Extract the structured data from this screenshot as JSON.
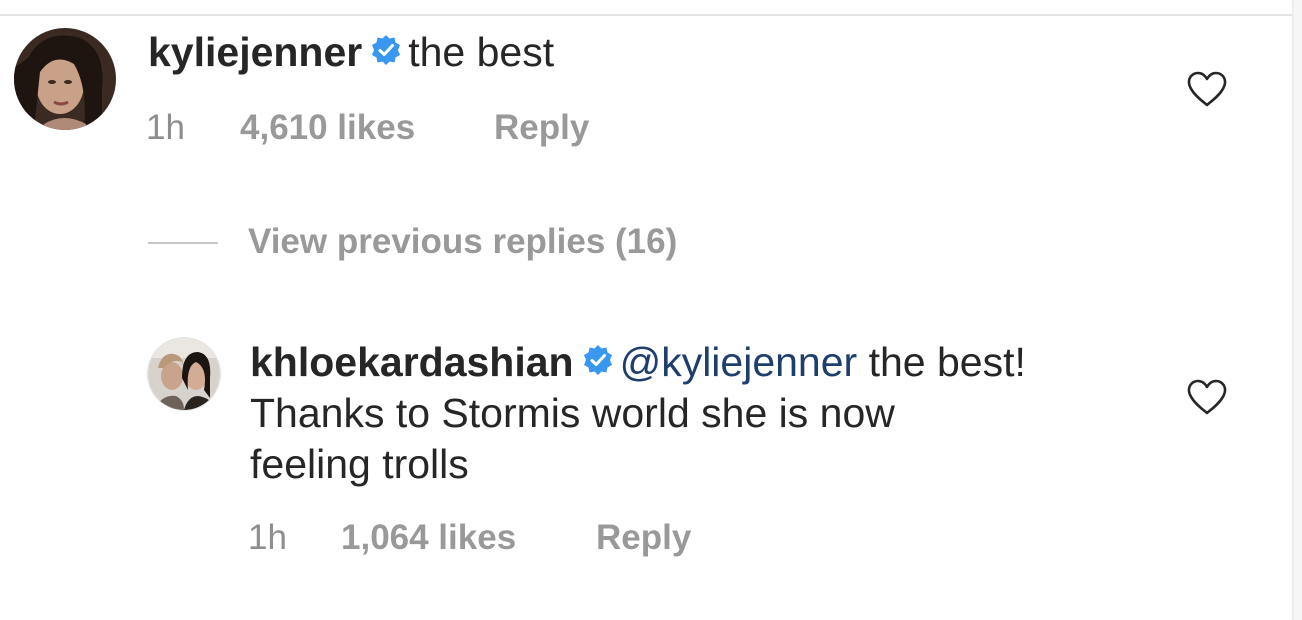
{
  "comment": {
    "username": "kyliejenner",
    "text": "the best",
    "time": "1h",
    "likes": "4,610 likes",
    "reply_label": "Reply"
  },
  "thread": {
    "view_replies_label": "View previous replies (16)"
  },
  "reply": {
    "username": "khloekardashian",
    "mention": "@kyliejenner",
    "text_line1": "the best!",
    "text_line2": "Thanks to Stormis world she is now",
    "text_line3": "feeling trolls",
    "time": "1h",
    "likes": "1,064 likes",
    "reply_label": "Reply"
  },
  "icons": {
    "verified": "verified-badge-icon",
    "like": "heart-outline-icon"
  },
  "colors": {
    "verified_blue": "#3897f0",
    "mention_blue": "#1e3f6d",
    "muted_gray": "#8e8e8e",
    "text": "#262626"
  }
}
